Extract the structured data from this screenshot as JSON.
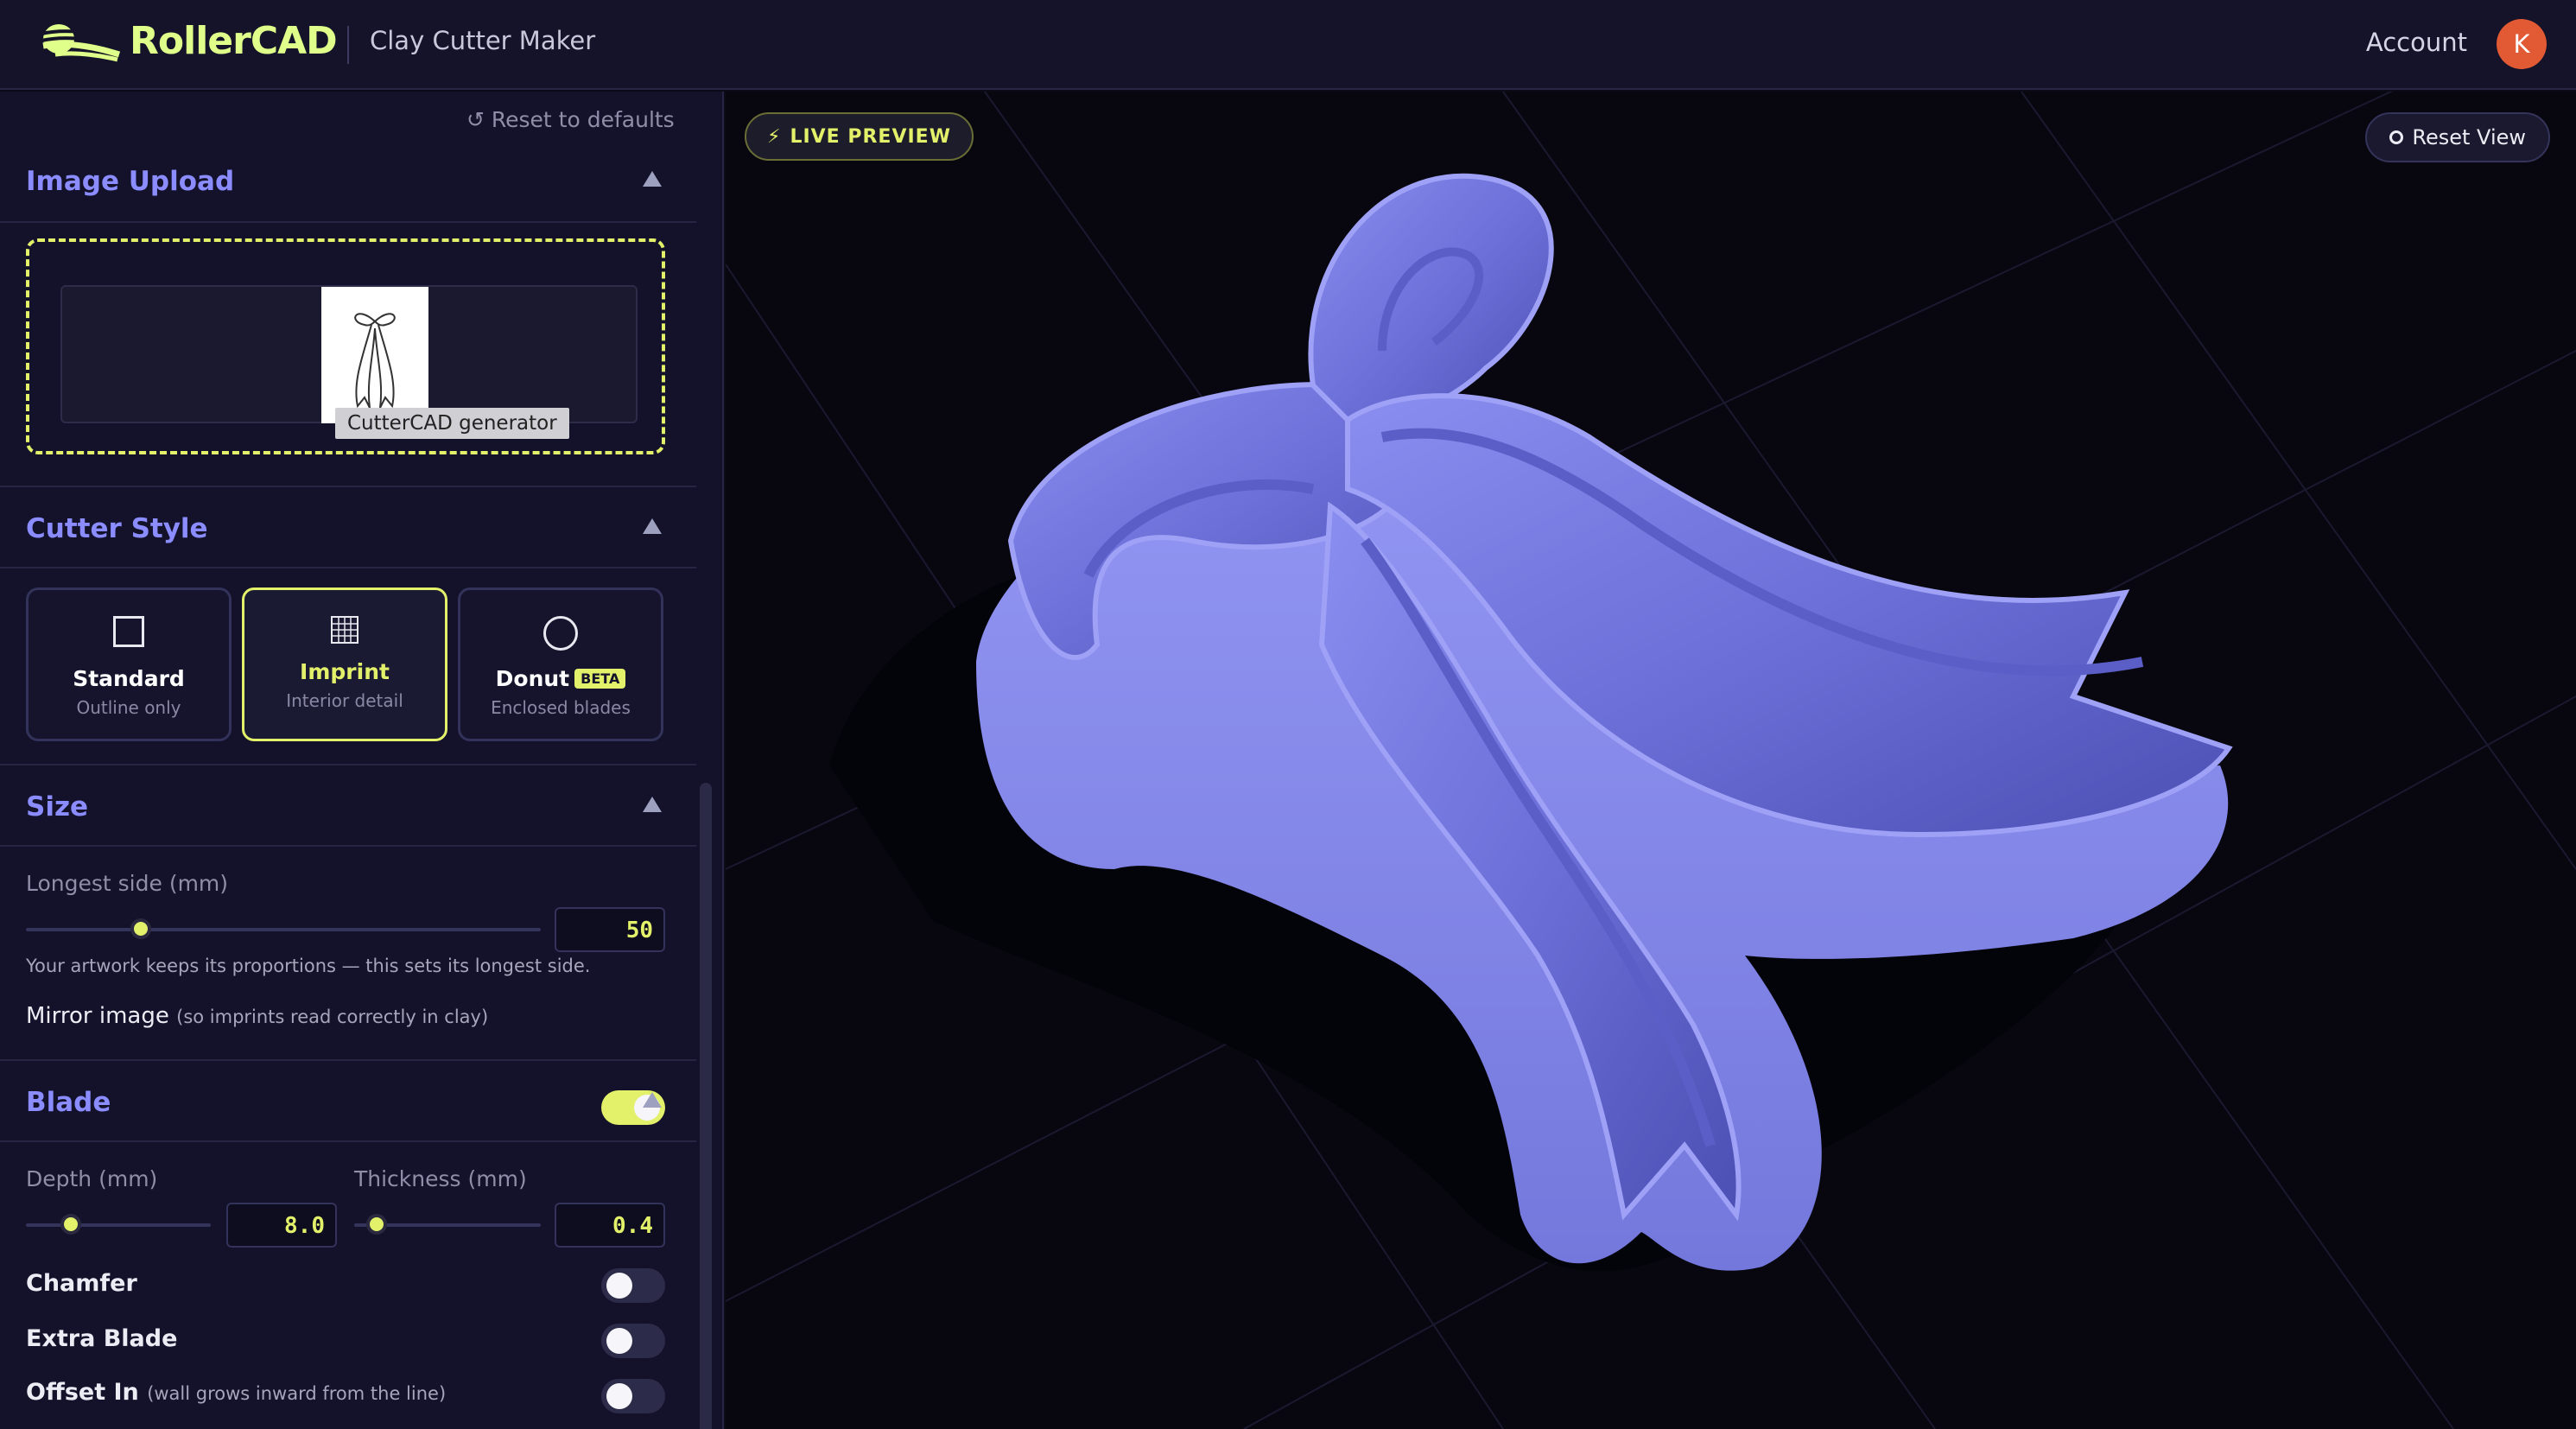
{
  "header": {
    "brand": "RollerCAD",
    "subtitle": "Clay Cutter Maker",
    "account_label": "Account",
    "avatar_initial": "K"
  },
  "sidebar": {
    "reset_defaults": "↺ Reset to defaults",
    "image_upload": {
      "title": "Image Upload",
      "tooltip": "CutterCAD generator"
    },
    "cutter_style": {
      "title": "Cutter Style",
      "options": [
        {
          "name": "Standard",
          "sub": "Outline only",
          "selected": false
        },
        {
          "name": "Imprint",
          "sub": "Interior detail",
          "selected": true
        },
        {
          "name": "Donut",
          "badge": "BETA",
          "sub": "Enclosed blades",
          "selected": false
        }
      ]
    },
    "size": {
      "title": "Size",
      "longest_label": "Longest side (mm)",
      "longest_value": "50",
      "help": "Your artwork keeps its proportions — this sets its longest side.",
      "mirror_label": "Mirror image",
      "mirror_hint": "(so imprints read correctly in clay)",
      "mirror_on": true
    },
    "blade": {
      "title": "Blade",
      "depth_label": "Depth (mm)",
      "depth_value": "8.0",
      "thickness_label": "Thickness (mm)",
      "thickness_value": "0.4",
      "chamfer_label": "Chamfer",
      "chamfer_on": false,
      "extra_label": "Extra Blade",
      "extra_on": false,
      "offset_label": "Offset In",
      "offset_hint": "(wall grows inward from the line)",
      "offset_on": false
    }
  },
  "viewport": {
    "live_preview": "LIVE PREVIEW",
    "reset_view": "Reset View",
    "model_color": "#7b7fe6"
  },
  "colors": {
    "accent": "#e2f06a",
    "heading": "#8a8cff",
    "avatar": "#e25a33"
  }
}
